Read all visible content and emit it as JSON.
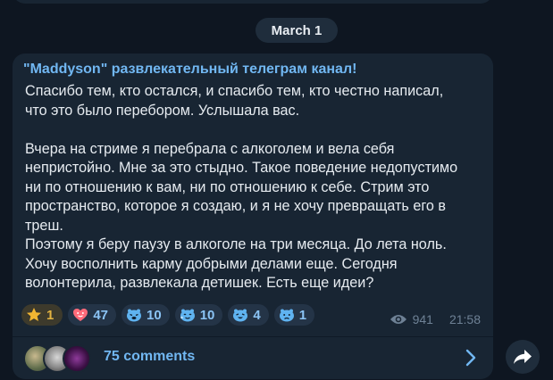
{
  "date_label": "March 1",
  "post": {
    "channel_name": "\"Maddyson\" развлекательный телеграм канал!",
    "text": "Спасибо тем, кто остался, и спасибо тем, кто честно написал,\nчто это было перебором. Услышала вас.\n\nВчера на стриме я перебрала с алкоголем и вела себя\nнепристойно. Мне за это стыдно. Такое поведение недопустимо\nни по отношению к вам, ни по отношению к себе. Стрим это\nпространство, которое я создаю, и я не хочу превращать его в\nтреш.\nПоэтому я беру паузу в алкоголе на три месяца. До лета ноль.\nХочу восполнить карму добрыми делами еще. Сегодня\nволонтерила, развлекала детишек. Есть еще идеи?",
    "reactions": [
      {
        "icon": "star-icon",
        "count": "1"
      },
      {
        "icon": "heart-face-icon",
        "count": "47"
      },
      {
        "icon": "crying-face-icon",
        "count": "10"
      },
      {
        "icon": "tears-face-icon",
        "count": "10"
      },
      {
        "icon": "laughing-face-icon",
        "count": "4"
      },
      {
        "icon": "sad-face-icon",
        "count": "1"
      }
    ],
    "views": "941",
    "time": "21:58",
    "comments_label": "75 comments"
  },
  "colors": {
    "background": "#0e1621",
    "bubble": "#182533",
    "accent": "#71b7f2",
    "star": "#e3b341"
  }
}
